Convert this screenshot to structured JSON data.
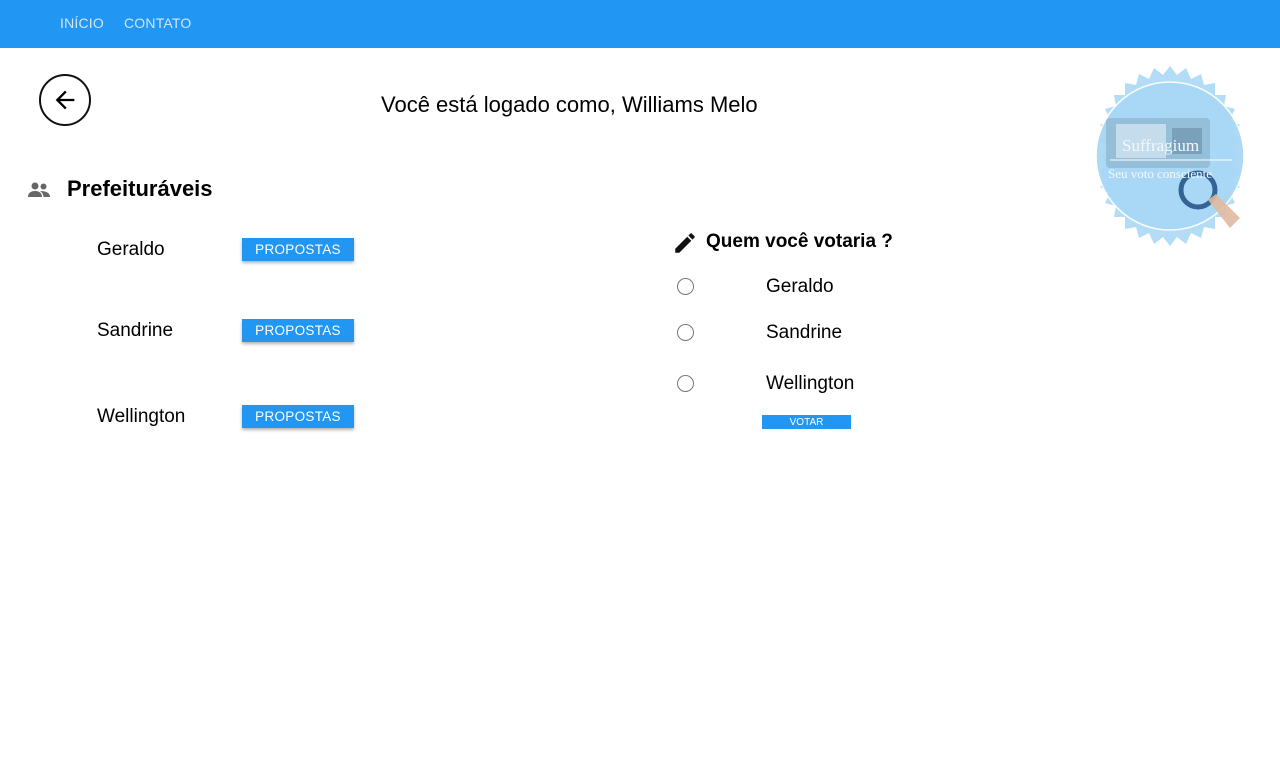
{
  "nav": {
    "items": [
      {
        "label": "INÍCIO"
      },
      {
        "label": "CONTATO"
      }
    ],
    "color": "#2196f3"
  },
  "header": {
    "welcome_prefix": "Você está logado como,",
    "user_name": "Williams Melo",
    "back_icon": "arrow-left-icon"
  },
  "logo": {
    "title": "Suffragium",
    "tagline": "Seu voto consciente"
  },
  "candidates_section": {
    "title": "Prefeituráveis",
    "icon": "people-icon",
    "candidates": [
      {
        "name": "Geraldo",
        "button": "PROPOSTAS"
      },
      {
        "name": "Sandrine",
        "button": "PROPOSTAS"
      },
      {
        "name": "Wellington",
        "button": "PROPOSTAS"
      }
    ]
  },
  "vote_section": {
    "title": "Quem você votaria ?",
    "icon": "pencil-icon",
    "options": [
      {
        "label": "Geraldo",
        "selected": false
      },
      {
        "label": "Sandrine",
        "selected": false
      },
      {
        "label": "Wellington",
        "selected": false
      }
    ],
    "submit_label": "VOTAR"
  }
}
